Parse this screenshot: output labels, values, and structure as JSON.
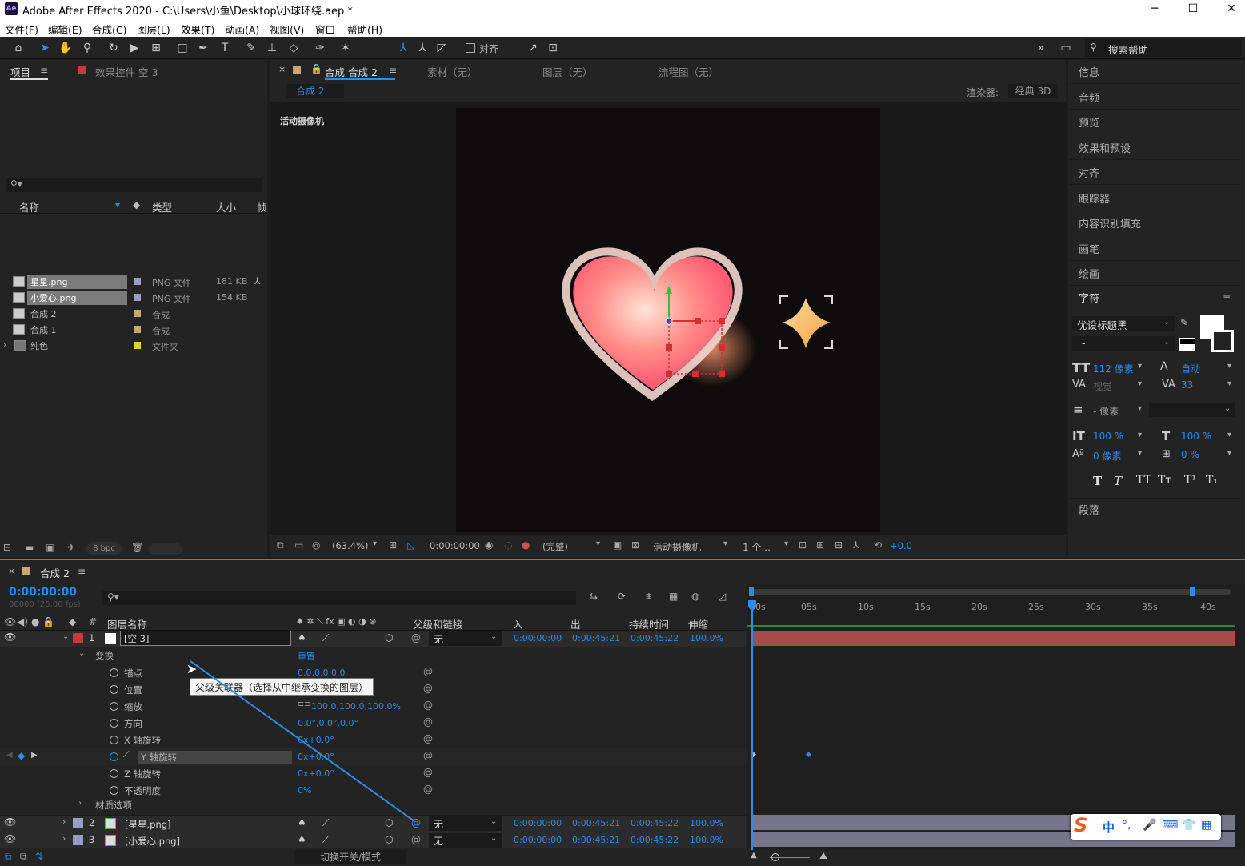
{
  "window": {
    "title": "Adobe After Effects 2020 - C:\\Users\\小鱼\\Desktop\\小球环绕.aep *",
    "app_icon": "Ae"
  },
  "menu": [
    "文件(F)",
    "编辑(E)",
    "合成(C)",
    "图层(L)",
    "效果(T)",
    "动画(A)",
    "视图(V)",
    "窗口",
    "帮助(H)"
  ],
  "toolbar": {
    "align_label": "对齐",
    "search_placeholder": "搜索帮助"
  },
  "project": {
    "tab": "项目",
    "effects_tab": "效果控件 空 3",
    "columns": [
      "名称",
      "类型",
      "大小",
      "帧"
    ],
    "items": [
      {
        "name": "星星.png",
        "type": "PNG 文件",
        "size": "181 KB",
        "color": "#9a9ac8"
      },
      {
        "name": "小爱心.png",
        "type": "PNG 文件",
        "size": "154 KB",
        "color": "#9a9ac8"
      },
      {
        "name": "合成 2",
        "type": "合成",
        "size": "",
        "color": "#c8a870"
      },
      {
        "name": "合成 1",
        "type": "合成",
        "size": "",
        "color": "#c8a870"
      },
      {
        "name": "纯色",
        "type": "文件夹",
        "size": "",
        "color": "#e8c840"
      }
    ],
    "bpc": "8 bpc"
  },
  "viewer": {
    "tabs": {
      "comp": "合成 合成 2",
      "footage": "素材（无）",
      "layer": "图层（无）",
      "flow": "流程图（无）"
    },
    "subtab": "合成 2",
    "renderer_label": "渲染器:",
    "renderer_value": "经典 3D",
    "camera_label": "活动摄像机",
    "zoom": "(63.4%)",
    "timecode": "0:00:00:00",
    "quality": "(完整)",
    "camera_select": "活动摄像机",
    "views": "1 个...",
    "exposure": "+0.0"
  },
  "right_panel": {
    "items": [
      "信息",
      "音频",
      "预览",
      "效果和预设",
      "对齐",
      "跟踪器",
      "内容识别填充",
      "画笔",
      "绘画"
    ],
    "character": {
      "title": "字符",
      "font": "优设标题黑",
      "style": "-",
      "size": "112 像素",
      "leading": "自动",
      "kerning": "视觉",
      "tracking": "33",
      "stroke": "- 像素",
      "vscale": "100 %",
      "hscale": "100 %",
      "baseline": "0 像素",
      "tsume": "0 %"
    },
    "paragraph": "段落"
  },
  "timeline": {
    "tab": "合成 2",
    "timecode": "0:00:00:00",
    "fps": "00000 (25.00 fps)",
    "columns": {
      "layer_name": "图层名称",
      "parent": "父级和链接",
      "in": "入",
      "out": "出",
      "duration": "持续时间",
      "stretch": "伸缩"
    },
    "ruler": [
      "0s",
      "05s",
      "10s",
      "15s",
      "20s",
      "25s",
      "30s",
      "35s",
      "40s"
    ],
    "layers": [
      {
        "num": "1",
        "name": "[空 3]",
        "parent": "无",
        "in": "0:00:00:00",
        "out": "0:00:45:21",
        "dur": "0:00:45:22",
        "stretch": "100.0%",
        "label_color": "#c83a3a"
      },
      {
        "num": "2",
        "name": "[星星.png]",
        "parent": "无",
        "in": "0:00:00:00",
        "out": "0:00:45:21",
        "dur": "0:00:45:22",
        "stretch": "100.0%",
        "label_color": "#9a9ac8"
      },
      {
        "num": "3",
        "name": "[小爱心.png]",
        "parent": "无",
        "in": "0:00:00:00",
        "out": "0:00:45:21",
        "dur": "0:00:45:22",
        "stretch": "100.0%",
        "label_color": "#9a9ac8"
      }
    ],
    "transform": {
      "label": "变换",
      "reset": "重置"
    },
    "props": [
      {
        "name": "锚点",
        "value": "0.0,0.0,0.0"
      },
      {
        "name": "位置",
        "value": ""
      },
      {
        "name": "缩放",
        "value": "100.0,100.0,100.0%"
      },
      {
        "name": "方向",
        "value": "0.0°,0.0°,0.0°"
      },
      {
        "name": "X 轴旋转",
        "value": "0x+0.0°"
      },
      {
        "name": "Y 轴旋转",
        "value": "0x+0.0°"
      },
      {
        "name": "Z 轴旋转",
        "value": "0x+0.0°"
      },
      {
        "name": "不透明度",
        "value": "0%"
      }
    ],
    "material": "材质选项",
    "tooltip": "父级关联器（选择从中继承变换的图层）",
    "footer": "切换开关/模式"
  },
  "ime": {
    "logo": "S",
    "lang": "中"
  }
}
